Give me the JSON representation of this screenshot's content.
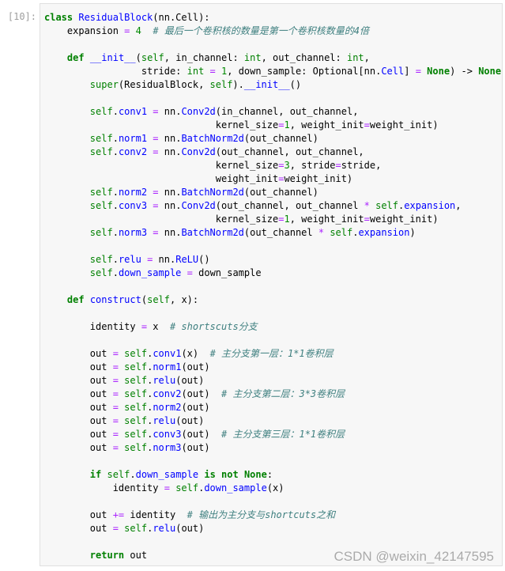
{
  "cell": {
    "prompt": "[10]:",
    "lines": [
      [
        [
          "kw",
          "class"
        ],
        [
          "p",
          " "
        ],
        [
          "nm",
          "ResidualBlock"
        ],
        [
          "p",
          "(nn.Cell):"
        ]
      ],
      [
        [
          "p",
          "    expansion "
        ],
        [
          "op",
          "="
        ],
        [
          "p",
          " "
        ],
        [
          "num",
          "4"
        ],
        [
          "p",
          "  "
        ],
        [
          "cm",
          "# 最后一个卷积核的数量是第一个卷积核数量的4倍"
        ]
      ],
      [],
      [
        [
          "p",
          "    "
        ],
        [
          "kw",
          "def"
        ],
        [
          "p",
          " "
        ],
        [
          "nm",
          "__init__"
        ],
        [
          "p",
          "("
        ],
        [
          "sf",
          "self"
        ],
        [
          "p",
          ", in_channel: "
        ],
        [
          "bi",
          "int"
        ],
        [
          "p",
          ", out_channel: "
        ],
        [
          "bi",
          "int"
        ],
        [
          "p",
          ","
        ]
      ],
      [
        [
          "p",
          "                 stride: "
        ],
        [
          "bi",
          "int"
        ],
        [
          "p",
          " "
        ],
        [
          "op",
          "="
        ],
        [
          "p",
          " "
        ],
        [
          "num",
          "1"
        ],
        [
          "p",
          ", down_sample: Optional[nn."
        ],
        [
          "nm",
          "Cell"
        ],
        [
          "p",
          "] "
        ],
        [
          "op",
          "="
        ],
        [
          "p",
          " "
        ],
        [
          "kw",
          "None"
        ],
        [
          "p",
          ") -> "
        ],
        [
          "kw",
          "None"
        ],
        [
          "p",
          ":"
        ]
      ],
      [
        [
          "p",
          "        "
        ],
        [
          "bi",
          "super"
        ],
        [
          "p",
          "(ResidualBlock, "
        ],
        [
          "sf",
          "self"
        ],
        [
          "p",
          ")."
        ],
        [
          "nm",
          "__init__"
        ],
        [
          "p",
          "()"
        ]
      ],
      [],
      [
        [
          "p",
          "        "
        ],
        [
          "sf",
          "self"
        ],
        [
          "p",
          "."
        ],
        [
          "nm",
          "conv1"
        ],
        [
          "p",
          " "
        ],
        [
          "op",
          "="
        ],
        [
          "p",
          " nn."
        ],
        [
          "nm",
          "Conv2d"
        ],
        [
          "p",
          "(in_channel, out_channel,"
        ]
      ],
      [
        [
          "p",
          "                              kernel_size"
        ],
        [
          "op",
          "="
        ],
        [
          "num",
          "1"
        ],
        [
          "p",
          ", weight_init"
        ],
        [
          "op",
          "="
        ],
        [
          "p",
          "weight_init)"
        ]
      ],
      [
        [
          "p",
          "        "
        ],
        [
          "sf",
          "self"
        ],
        [
          "p",
          "."
        ],
        [
          "nm",
          "norm1"
        ],
        [
          "p",
          " "
        ],
        [
          "op",
          "="
        ],
        [
          "p",
          " nn."
        ],
        [
          "nm",
          "BatchNorm2d"
        ],
        [
          "p",
          "(out_channel)"
        ]
      ],
      [
        [
          "p",
          "        "
        ],
        [
          "sf",
          "self"
        ],
        [
          "p",
          "."
        ],
        [
          "nm",
          "conv2"
        ],
        [
          "p",
          " "
        ],
        [
          "op",
          "="
        ],
        [
          "p",
          " nn."
        ],
        [
          "nm",
          "Conv2d"
        ],
        [
          "p",
          "(out_channel, out_channel,"
        ]
      ],
      [
        [
          "p",
          "                              kernel_size"
        ],
        [
          "op",
          "="
        ],
        [
          "num",
          "3"
        ],
        [
          "p",
          ", stride"
        ],
        [
          "op",
          "="
        ],
        [
          "p",
          "stride,"
        ]
      ],
      [
        [
          "p",
          "                              weight_init"
        ],
        [
          "op",
          "="
        ],
        [
          "p",
          "weight_init)"
        ]
      ],
      [
        [
          "p",
          "        "
        ],
        [
          "sf",
          "self"
        ],
        [
          "p",
          "."
        ],
        [
          "nm",
          "norm2"
        ],
        [
          "p",
          " "
        ],
        [
          "op",
          "="
        ],
        [
          "p",
          " nn."
        ],
        [
          "nm",
          "BatchNorm2d"
        ],
        [
          "p",
          "(out_channel)"
        ]
      ],
      [
        [
          "p",
          "        "
        ],
        [
          "sf",
          "self"
        ],
        [
          "p",
          "."
        ],
        [
          "nm",
          "conv3"
        ],
        [
          "p",
          " "
        ],
        [
          "op",
          "="
        ],
        [
          "p",
          " nn."
        ],
        [
          "nm",
          "Conv2d"
        ],
        [
          "p",
          "(out_channel, out_channel "
        ],
        [
          "op",
          "*"
        ],
        [
          "p",
          " "
        ],
        [
          "sf",
          "self"
        ],
        [
          "p",
          "."
        ],
        [
          "nm",
          "expansion"
        ],
        [
          "p",
          ","
        ]
      ],
      [
        [
          "p",
          "                              kernel_size"
        ],
        [
          "op",
          "="
        ],
        [
          "num",
          "1"
        ],
        [
          "p",
          ", weight_init"
        ],
        [
          "op",
          "="
        ],
        [
          "p",
          "weight_init)"
        ]
      ],
      [
        [
          "p",
          "        "
        ],
        [
          "sf",
          "self"
        ],
        [
          "p",
          "."
        ],
        [
          "nm",
          "norm3"
        ],
        [
          "p",
          " "
        ],
        [
          "op",
          "="
        ],
        [
          "p",
          " nn."
        ],
        [
          "nm",
          "BatchNorm2d"
        ],
        [
          "p",
          "(out_channel "
        ],
        [
          "op",
          "*"
        ],
        [
          "p",
          " "
        ],
        [
          "sf",
          "self"
        ],
        [
          "p",
          "."
        ],
        [
          "nm",
          "expansion"
        ],
        [
          "p",
          ")"
        ]
      ],
      [],
      [
        [
          "p",
          "        "
        ],
        [
          "sf",
          "self"
        ],
        [
          "p",
          "."
        ],
        [
          "nm",
          "relu"
        ],
        [
          "p",
          " "
        ],
        [
          "op",
          "="
        ],
        [
          "p",
          " nn."
        ],
        [
          "nm",
          "ReLU"
        ],
        [
          "p",
          "()"
        ]
      ],
      [
        [
          "p",
          "        "
        ],
        [
          "sf",
          "self"
        ],
        [
          "p",
          "."
        ],
        [
          "nm",
          "down_sample"
        ],
        [
          "p",
          " "
        ],
        [
          "op",
          "="
        ],
        [
          "p",
          " down_sample"
        ]
      ],
      [],
      [
        [
          "p",
          "    "
        ],
        [
          "kw",
          "def"
        ],
        [
          "p",
          " "
        ],
        [
          "nm",
          "construct"
        ],
        [
          "p",
          "("
        ],
        [
          "sf",
          "self"
        ],
        [
          "p",
          ", x):"
        ]
      ],
      [],
      [
        [
          "p",
          "        identity "
        ],
        [
          "op",
          "="
        ],
        [
          "p",
          " x  "
        ],
        [
          "cm",
          "# shortscuts分支"
        ]
      ],
      [],
      [
        [
          "p",
          "        out "
        ],
        [
          "op",
          "="
        ],
        [
          "p",
          " "
        ],
        [
          "sf",
          "self"
        ],
        [
          "p",
          "."
        ],
        [
          "nm",
          "conv1"
        ],
        [
          "p",
          "(x)  "
        ],
        [
          "cm",
          "# 主分支第一层：1*1卷积层"
        ]
      ],
      [
        [
          "p",
          "        out "
        ],
        [
          "op",
          "="
        ],
        [
          "p",
          " "
        ],
        [
          "sf",
          "self"
        ],
        [
          "p",
          "."
        ],
        [
          "nm",
          "norm1"
        ],
        [
          "p",
          "(out)"
        ]
      ],
      [
        [
          "p",
          "        out "
        ],
        [
          "op",
          "="
        ],
        [
          "p",
          " "
        ],
        [
          "sf",
          "self"
        ],
        [
          "p",
          "."
        ],
        [
          "nm",
          "relu"
        ],
        [
          "p",
          "(out)"
        ]
      ],
      [
        [
          "p",
          "        out "
        ],
        [
          "op",
          "="
        ],
        [
          "p",
          " "
        ],
        [
          "sf",
          "self"
        ],
        [
          "p",
          "."
        ],
        [
          "nm",
          "conv2"
        ],
        [
          "p",
          "(out)  "
        ],
        [
          "cm",
          "# 主分支第二层：3*3卷积层"
        ]
      ],
      [
        [
          "p",
          "        out "
        ],
        [
          "op",
          "="
        ],
        [
          "p",
          " "
        ],
        [
          "sf",
          "self"
        ],
        [
          "p",
          "."
        ],
        [
          "nm",
          "norm2"
        ],
        [
          "p",
          "(out)"
        ]
      ],
      [
        [
          "p",
          "        out "
        ],
        [
          "op",
          "="
        ],
        [
          "p",
          " "
        ],
        [
          "sf",
          "self"
        ],
        [
          "p",
          "."
        ],
        [
          "nm",
          "relu"
        ],
        [
          "p",
          "(out)"
        ]
      ],
      [
        [
          "p",
          "        out "
        ],
        [
          "op",
          "="
        ],
        [
          "p",
          " "
        ],
        [
          "sf",
          "self"
        ],
        [
          "p",
          "."
        ],
        [
          "nm",
          "conv3"
        ],
        [
          "p",
          "(out)  "
        ],
        [
          "cm",
          "# 主分支第三层：1*1卷积层"
        ]
      ],
      [
        [
          "p",
          "        out "
        ],
        [
          "op",
          "="
        ],
        [
          "p",
          " "
        ],
        [
          "sf",
          "self"
        ],
        [
          "p",
          "."
        ],
        [
          "nm",
          "norm3"
        ],
        [
          "p",
          "(out)"
        ]
      ],
      [],
      [
        [
          "p",
          "        "
        ],
        [
          "kw",
          "if"
        ],
        [
          "p",
          " "
        ],
        [
          "sf",
          "self"
        ],
        [
          "p",
          "."
        ],
        [
          "nm",
          "down_sample"
        ],
        [
          "p",
          " "
        ],
        [
          "kw",
          "is not"
        ],
        [
          "p",
          " "
        ],
        [
          "kw",
          "None"
        ],
        [
          "p",
          ":"
        ]
      ],
      [
        [
          "p",
          "            identity "
        ],
        [
          "op",
          "="
        ],
        [
          "p",
          " "
        ],
        [
          "sf",
          "self"
        ],
        [
          "p",
          "."
        ],
        [
          "nm",
          "down_sample"
        ],
        [
          "p",
          "(x)"
        ]
      ],
      [],
      [
        [
          "p",
          "        out "
        ],
        [
          "op",
          "+="
        ],
        [
          "p",
          " identity  "
        ],
        [
          "cm",
          "# 输出为主分支与shortcuts之和"
        ]
      ],
      [
        [
          "p",
          "        out "
        ],
        [
          "op",
          "="
        ],
        [
          "p",
          " "
        ],
        [
          "sf",
          "self"
        ],
        [
          "p",
          "."
        ],
        [
          "nm",
          "relu"
        ],
        [
          "p",
          "(out)"
        ]
      ],
      [],
      [
        [
          "p",
          "        "
        ],
        [
          "kw",
          "return"
        ],
        [
          "p",
          " out"
        ]
      ]
    ]
  },
  "watermark": "CSDN @weixin_42147595"
}
